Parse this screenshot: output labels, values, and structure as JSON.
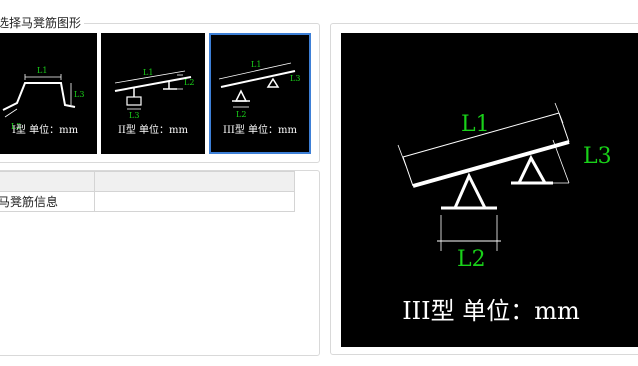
{
  "group": {
    "title": "选择马凳筋图形"
  },
  "shapes": [
    {
      "caption": "I型 单位：mm",
      "labels": [
        "L1",
        "L2",
        "L3"
      ],
      "selected": false
    },
    {
      "caption": "II型 单位：mm",
      "labels": [
        "L1",
        "L2",
        "L3"
      ],
      "selected": false
    },
    {
      "caption": "III型 单位：mm",
      "labels": [
        "L1",
        "L2",
        "L3"
      ],
      "selected": true
    }
  ],
  "table": {
    "header": [
      "",
      ""
    ],
    "rows": [
      {
        "name": "马凳筋信息",
        "value": ""
      }
    ]
  },
  "preview": {
    "caption": "III型  单位：mm",
    "labels": [
      "L1",
      "L2",
      "L3"
    ]
  }
}
